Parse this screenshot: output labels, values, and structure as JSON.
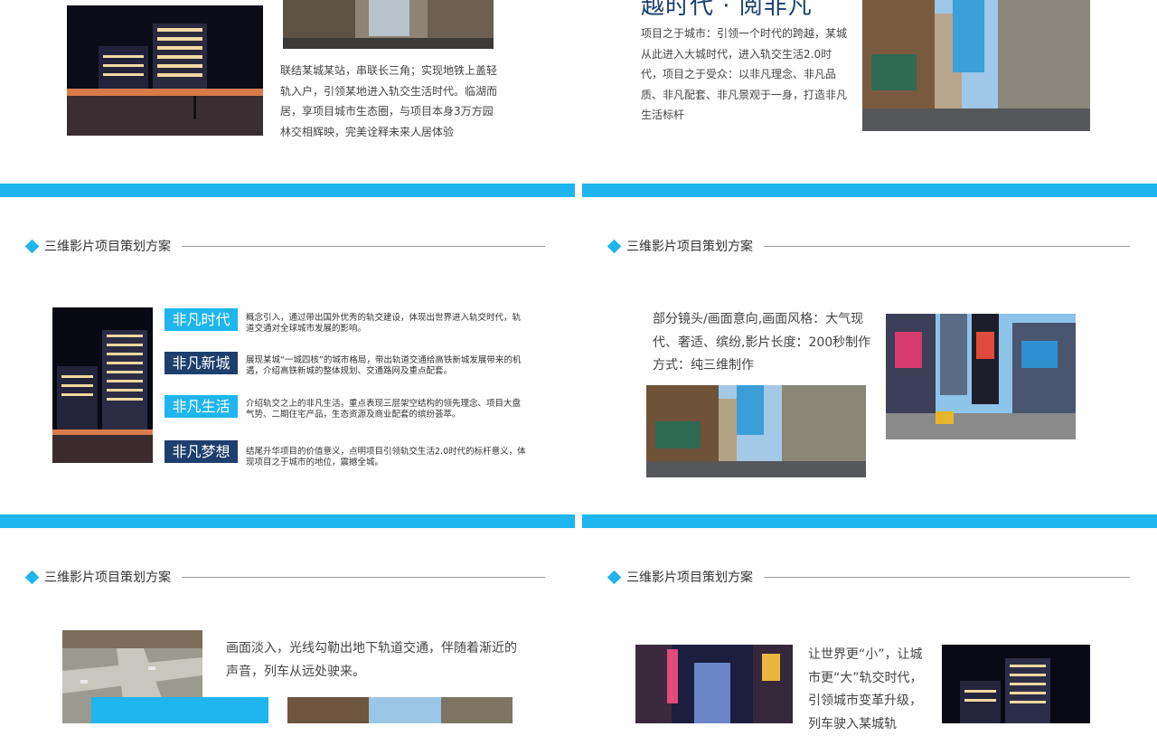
{
  "colors": {
    "accent": "#1fb5ee",
    "navy": "#1d3f6e"
  },
  "slide1": {
    "paragraph": "联结某城某站，串联长三角；实现地铁上盖轻轨入户，引领某地进入轨交生活时代。临湖而居，享项目城市生态圈，与项目本身3万方园林交相辉映，完美诠释未来人居体验"
  },
  "slide2": {
    "title": "越时代 · 阅非凡",
    "paragraph": "项目之于城市：引领一个时代的跨越，某城从此进入大城时代，进入轨交生活2.0时代，项目之于受众：以非凡理念、非凡品质、非凡配套、非凡景观于一身，打造非凡生活标杆"
  },
  "slide3": {
    "header": "三维影片项目策划方案",
    "items": [
      {
        "tag": "非凡时代",
        "desc": "概念引入，通过带出国外优秀的轨交建设，体现出世界进入轨交时代，轨道交通对全球城市发展的影响。"
      },
      {
        "tag": "非凡新城",
        "desc": "展现某城“一城四核”的城市格局，带出轨道交通给高铁新城发展带来的机遇，介绍高铁新城的整体规划、交通路网及重点配套。"
      },
      {
        "tag": "非凡生活",
        "desc": "介绍轨交之上的非凡生活，重点表现三层架空结构的领先理念、项目大盘气势、二期住宅产品，生态资源及商业配套的缤纷荟萃。"
      },
      {
        "tag": "非凡梦想",
        "desc": "结尾升华项目的价值意义，点明项目引领轨交生活2.0时代的标杆意义，体现项目之于城市的地位，震撼全城。"
      }
    ]
  },
  "slide4": {
    "header": "三维影片项目策划方案",
    "paragraph": "部分镜头/画面意向,画面风格：大气现代、奢适、缤纷,影片长度：200秒制作方式：纯三维制作"
  },
  "slide5": {
    "header": "三维影片项目策划方案",
    "paragraph": "画面淡入，光线勾勒出地下轨道交通，伴随着渐近的声音，列车从远处驶来。"
  },
  "slide6": {
    "header": "三维影片项目策划方案",
    "paragraph": "让世界更“小”，让城市更“大”轨交时代，引领城市变革升级，列车驶入某城轨"
  }
}
